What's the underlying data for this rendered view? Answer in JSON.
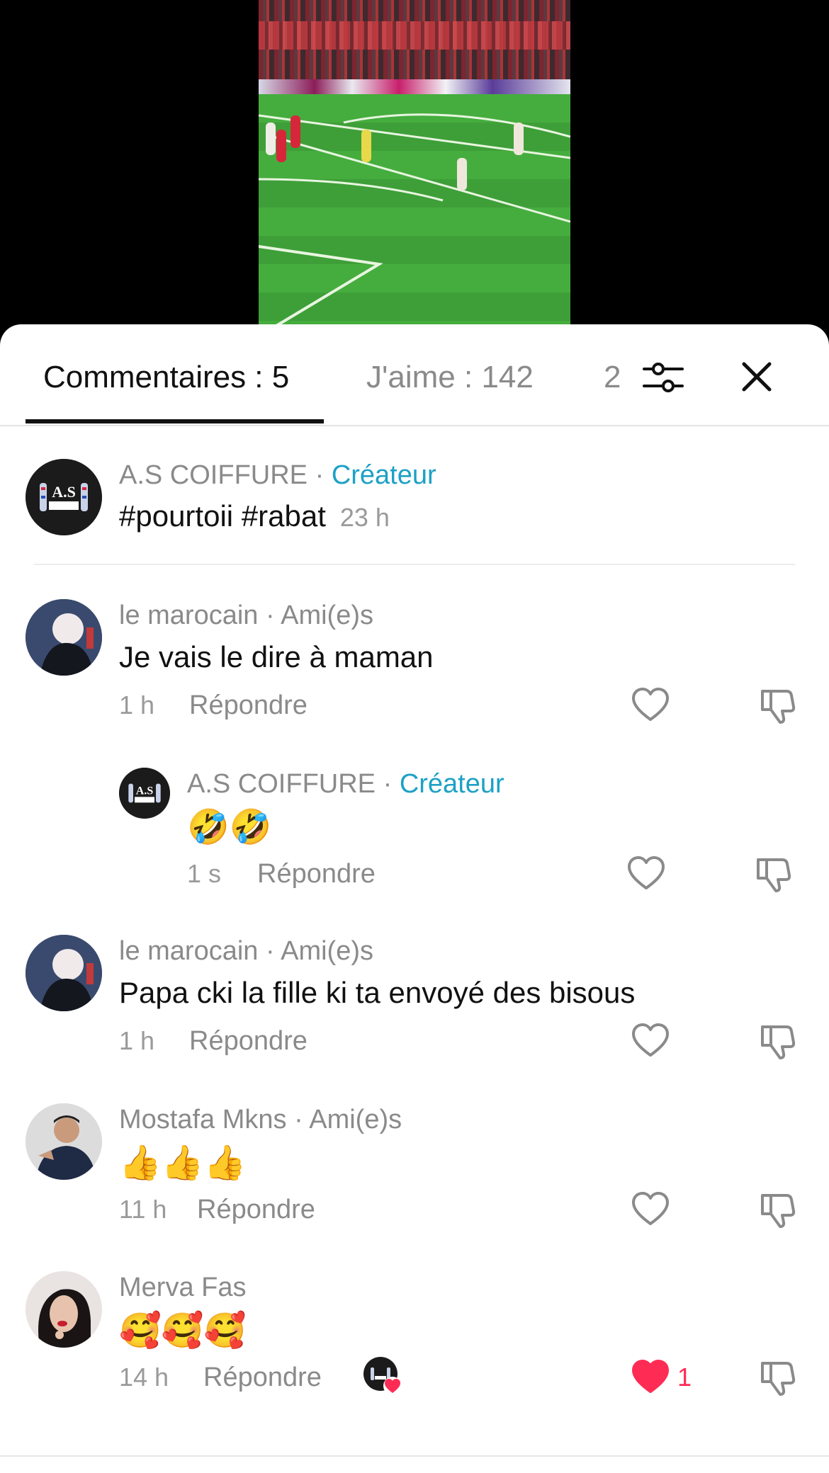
{
  "tabs": {
    "comments_label": "Commentaires : 5",
    "likes_label": "J'aime : 142",
    "more_label": "2"
  },
  "icons": {
    "filter": "sliders-icon",
    "close": "close-icon",
    "like": "heart-icon",
    "dislike": "thumbs-down-icon"
  },
  "colors": {
    "creator_accent": "#1da1c5",
    "like_active": "#fe2c55",
    "muted_text": "#8a8a8a"
  },
  "caption": {
    "username": "A.S COIFFURE",
    "separator": " · ",
    "role": "Créateur",
    "text": "#pourtoii #rabat",
    "time": "23 h",
    "avatar_text": "A.S"
  },
  "comments": [
    {
      "username": "le marocain",
      "separator": " · ",
      "relation": "Ami(e)s",
      "text": "Je vais le dire à maman",
      "time": "1 h",
      "reply_label": "Répondre"
    },
    {
      "username": "A.S COIFFURE",
      "separator": " · ",
      "relation": "Créateur",
      "text": "🤣🤣",
      "time": "1 s",
      "reply_label": "Répondre"
    },
    {
      "username": "le marocain",
      "separator": " · ",
      "relation": "Ami(e)s",
      "text": "Papa cki la fille ki ta envoyé des bisous",
      "time": "1 h",
      "reply_label": "Répondre"
    },
    {
      "username": "Mostafa Mkns",
      "separator": " · ",
      "relation": "Ami(e)s",
      "text": "👍👍👍",
      "time": "11 h",
      "reply_label": "Répondre"
    },
    {
      "username": "Merva Fas",
      "separator": "",
      "relation": "",
      "text": "🥰🥰🥰",
      "time": "14 h",
      "reply_label": "Répondre",
      "like_count": "1"
    }
  ]
}
